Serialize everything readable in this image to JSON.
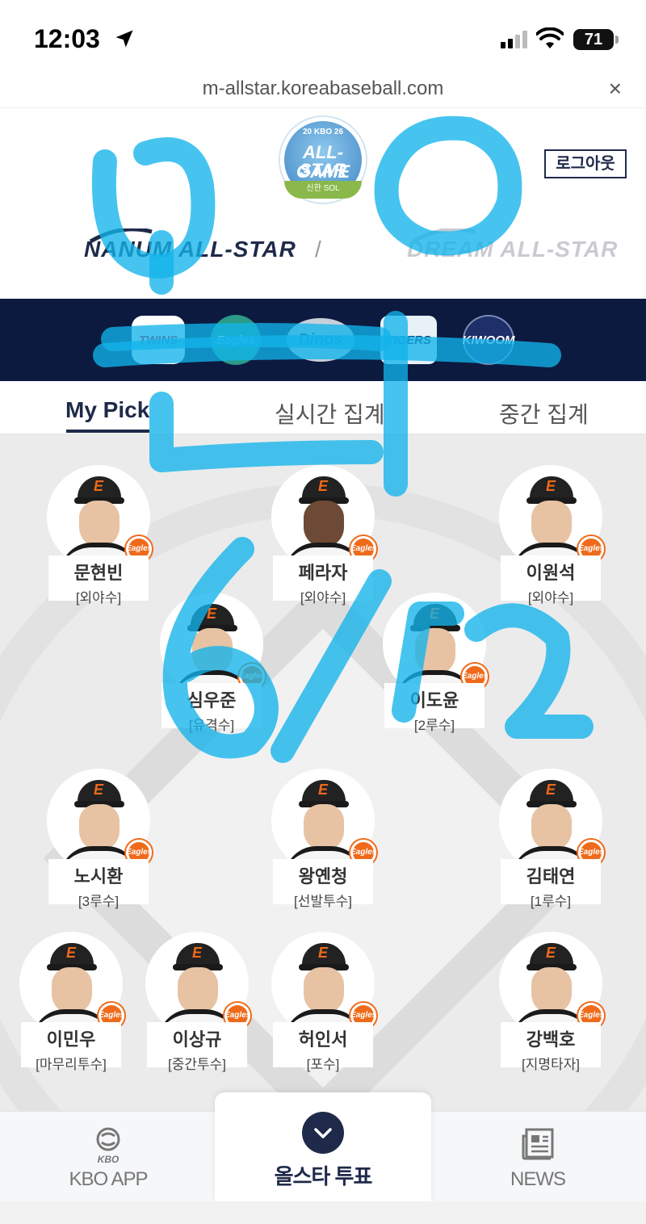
{
  "status_bar": {
    "time": "12:03",
    "battery": "71"
  },
  "browser": {
    "url": "m-allstar.koreabaseball.com",
    "close_label": "×"
  },
  "header": {
    "logo": {
      "year": "20 KBO 26",
      "title_line1": "ALL-STAR",
      "title_line2": "GAME",
      "sponsor": "신한 SOL"
    },
    "logout_label": "로그아웃",
    "league_nanum": "NANUM ALL-STAR",
    "league_dream": "DREAM ALL-STAR",
    "separator": "/"
  },
  "teams": [
    {
      "id": "lg",
      "label": "TWINS"
    },
    {
      "id": "eagles",
      "label": "Eagles"
    },
    {
      "id": "dinos",
      "label": "Dinos"
    },
    {
      "id": "tigers",
      "label": "TIGERS"
    },
    {
      "id": "kiwoom",
      "label": "KIWOOM"
    }
  ],
  "tabs": [
    "My Pick",
    "실시간 집계",
    "중간 집계"
  ],
  "team_badge": "Eagles",
  "players": [
    {
      "name": "문현빈",
      "position": "[외야수]"
    },
    {
      "name": "페라자",
      "position": "[외야수]"
    },
    {
      "name": "이원석",
      "position": "[외야수]"
    },
    {
      "name": "심우준",
      "position": "[유격수]"
    },
    {
      "name": "이도윤",
      "position": "[2루수]"
    },
    {
      "name": "노시환",
      "position": "[3루수]"
    },
    {
      "name": "왕옌청",
      "position": "[선발투수]"
    },
    {
      "name": "김태연",
      "position": "[1루수]"
    },
    {
      "name": "이민우",
      "position": "[마무리투수]"
    },
    {
      "name": "이상규",
      "position": "[중간투수]"
    },
    {
      "name": "허인서",
      "position": "[포수]"
    },
    {
      "name": "강백호",
      "position": "[지명타자]"
    }
  ],
  "bottom_nav": {
    "app_small": "KBO",
    "app_label": "KBO APP",
    "vote_label": "올스타 투표",
    "news_label": "NEWS"
  },
  "colors": {
    "navy": "#1f2a4a",
    "team_strip": "#0d1a3f",
    "eagles_orange": "#ef6a1a",
    "marker_blue": "#12b4ea"
  }
}
